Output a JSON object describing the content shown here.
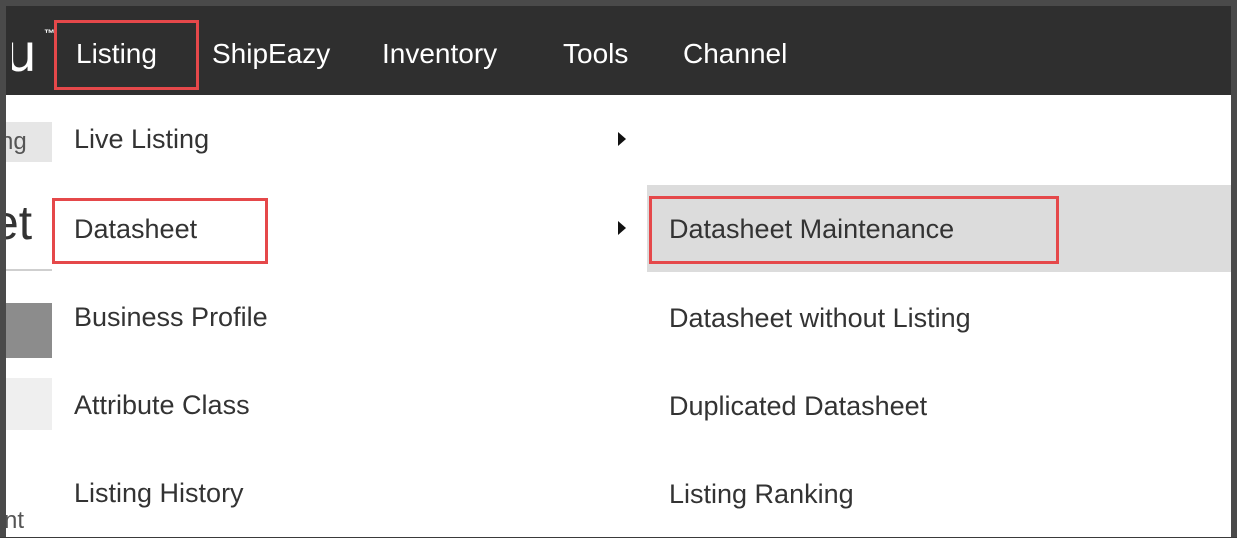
{
  "logo": {
    "glyph": "u",
    "trademark": "™"
  },
  "nav": {
    "items": [
      "Listing",
      "ShipEazy",
      "Inventory",
      "Tools",
      "Channel"
    ],
    "active": "Listing"
  },
  "background_page": {
    "tab_text": "ng",
    "title_text": "et",
    "bottom_text": "nt"
  },
  "listing_menu": {
    "items": [
      {
        "label": "Live Listing",
        "has_submenu": true
      },
      {
        "label": "Datasheet",
        "has_submenu": true,
        "selected": true
      },
      {
        "label": "Business Profile",
        "has_submenu": false
      },
      {
        "label": "Attribute Class",
        "has_submenu": false
      },
      {
        "label": "Listing History",
        "has_submenu": false
      }
    ]
  },
  "datasheet_submenu": {
    "items": [
      {
        "label": "",
        "empty": true
      },
      {
        "label": "Datasheet Maintenance",
        "selected": true
      },
      {
        "label": "Datasheet without Listing"
      },
      {
        "label": "Duplicated Datasheet"
      },
      {
        "label": "Listing Ranking"
      }
    ]
  },
  "colors": {
    "topbar": "#2f2f2f",
    "highlight": "#e5484a",
    "selected_row": "#dcdcdc",
    "menu_bg": "#ffffff"
  }
}
